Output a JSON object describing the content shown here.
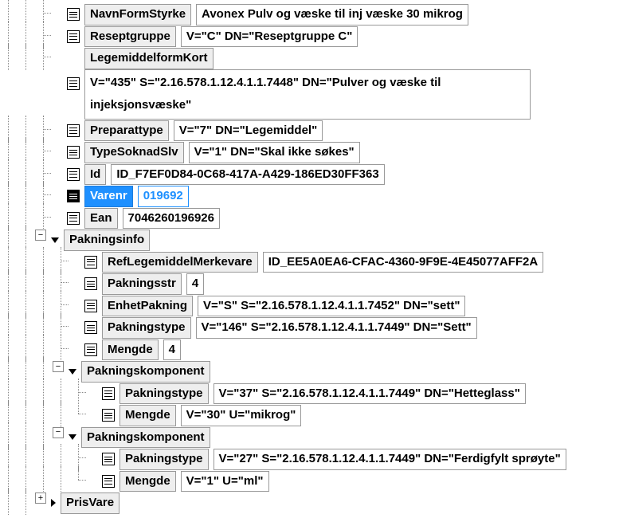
{
  "nodes": {
    "navnFormStyrke": {
      "label": "NavnFormStyrke",
      "value": "Avonex Pulv og væske til inj væske 30 mikrog"
    },
    "reseptgruppe": {
      "label": "Reseptgruppe",
      "value": "V=\"C\" DN=\"Reseptgruppe C\""
    },
    "legemiddelformKort": {
      "label": "LegemiddelformKort",
      "value": "V=\"435\" S=\"2.16.578.1.12.4.1.1.7448\" DN=\"Pulver og væske til injeksjonsvæske\""
    },
    "preparattype": {
      "label": "Preparattype",
      "value": "V=\"7\" DN=\"Legemiddel\""
    },
    "typeSoknadSlv": {
      "label": "TypeSoknadSlv",
      "value": "V=\"1\" DN=\"Skal ikke søkes\""
    },
    "id": {
      "label": "Id",
      "value": "ID_F7EF0D84-0C68-417A-A429-186ED30FF363"
    },
    "varenr": {
      "label": "Varenr",
      "value": "019692"
    },
    "ean": {
      "label": "Ean",
      "value": "7046260196926"
    },
    "pakningsinfo": {
      "label": "Pakningsinfo"
    },
    "refLegemiddelMerkevare": {
      "label": "RefLegemiddelMerkevare",
      "value": "ID_EE5A0EA6-CFAC-4360-9F9E-4E45077AFF2A"
    },
    "pakningsstr": {
      "label": "Pakningsstr",
      "value": "4"
    },
    "enhetPakning": {
      "label": "EnhetPakning",
      "value": "V=\"S\" S=\"2.16.578.1.12.4.1.1.7452\" DN=\"sett\""
    },
    "pakningstype": {
      "label": "Pakningstype",
      "value": "V=\"146\" S=\"2.16.578.1.12.4.1.1.7449\" DN=\"Sett\""
    },
    "mengde": {
      "label": "Mengde",
      "value": "4"
    },
    "pakningskomponent1": {
      "label": "Pakningskomponent"
    },
    "komp1_pakningstype": {
      "label": "Pakningstype",
      "value": "V=\"37\" S=\"2.16.578.1.12.4.1.1.7449\" DN=\"Hetteglass\""
    },
    "komp1_mengde": {
      "label": "Mengde",
      "value": "V=\"30\" U=\"mikrog\""
    },
    "pakningskomponent2": {
      "label": "Pakningskomponent"
    },
    "komp2_pakningstype": {
      "label": "Pakningstype",
      "value": "V=\"27\" S=\"2.16.578.1.12.4.1.1.7449\" DN=\"Ferdigfylt sprøyte\""
    },
    "komp2_mengde": {
      "label": "Mengde",
      "value": "V=\"1\" U=\"ml\""
    },
    "prisVare": {
      "label": "PrisVare"
    }
  },
  "toggles": {
    "minus": "−",
    "plus": "+"
  }
}
